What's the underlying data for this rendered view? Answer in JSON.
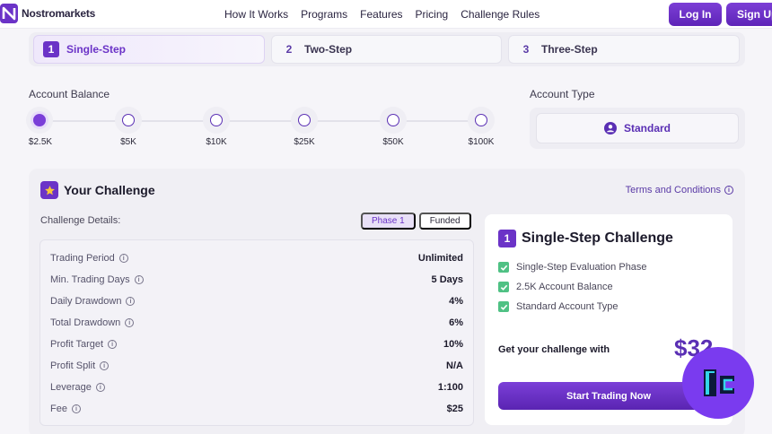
{
  "brand": {
    "name": "Nostromarkets"
  },
  "nav": {
    "links": [
      "How It Works",
      "Programs",
      "Features",
      "Pricing",
      "Challenge Rules"
    ],
    "login": "Log In",
    "signup": "Sign Up"
  },
  "steps": [
    {
      "num": "1",
      "label": "Single-Step",
      "active": true
    },
    {
      "num": "2",
      "label": "Two-Step",
      "active": false
    },
    {
      "num": "3",
      "label": "Three-Step",
      "active": false
    }
  ],
  "balance": {
    "label": "Account Balance",
    "options": [
      "$2.5K",
      "$5K",
      "$10K",
      "$25K",
      "$50K",
      "$100K"
    ],
    "selected": "$2.5K"
  },
  "account_type": {
    "label": "Account Type",
    "selected": "Standard"
  },
  "challenge": {
    "title": "Your Challenge",
    "terms": "Terms and Conditions",
    "details_label": "Challenge Details:",
    "phases": [
      "Phase 1",
      "Funded"
    ],
    "active_phase": "Phase 1",
    "rows": [
      {
        "label": "Trading Period",
        "value": "Unlimited"
      },
      {
        "label": "Min. Trading Days",
        "value": "5 Days"
      },
      {
        "label": "Daily Drawdown",
        "value": "4%"
      },
      {
        "label": "Total Drawdown",
        "value": "6%"
      },
      {
        "label": "Profit Target",
        "value": "10%"
      },
      {
        "label": "Profit Split",
        "value": "N/A"
      },
      {
        "label": "Leverage",
        "value": "1:100"
      },
      {
        "label": "Fee",
        "value": "$25"
      }
    ]
  },
  "summary": {
    "num": "1",
    "title": "Single-Step Challenge",
    "features": [
      "Single-Step Evaluation Phase",
      "2.5K Account Balance",
      "Standard Account Type"
    ],
    "get_label": "Get your challenge with",
    "price": "$32",
    "cta": "Start Trading Now"
  },
  "colors": {
    "accent": "#6b33c7",
    "check": "#4fc184",
    "watermark": "#7a3bef"
  }
}
